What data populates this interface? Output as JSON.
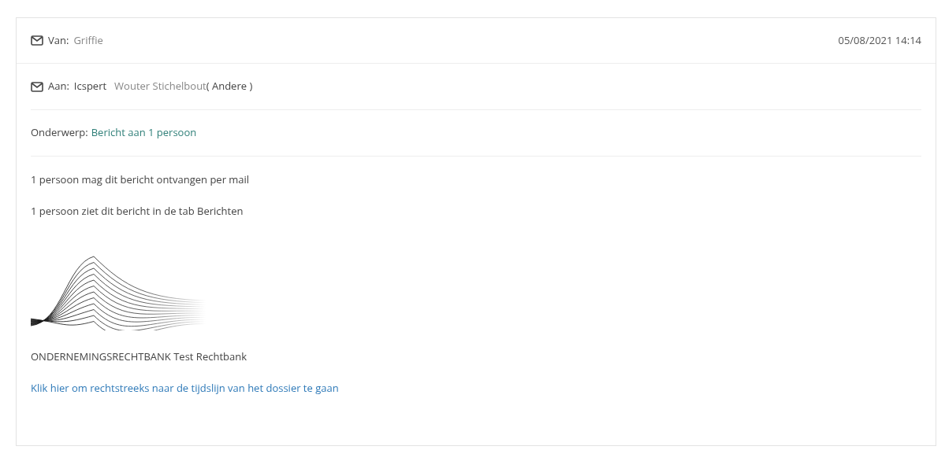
{
  "header": {
    "from_label": "Van:",
    "from_value": "Griffie",
    "date": "05/08/2021 14:14"
  },
  "to": {
    "label": "Aan:",
    "name": "Icspert",
    "recipient": "Wouter Stichelbout",
    "role": "( Andere )"
  },
  "subject": {
    "label": "Onderwerp:",
    "value": "Bericht aan 1 persoon"
  },
  "body": [
    "1 persoon mag dit bericht ontvangen per mail",
    "1 persoon ziet dit bericht in de tab Berichten"
  ],
  "signature": "ONDERNEMINGSRECHTBANK Test Rechtbank",
  "link": "Klik hier om rechtstreeks naar de tijdslijn van het dossier te gaan"
}
